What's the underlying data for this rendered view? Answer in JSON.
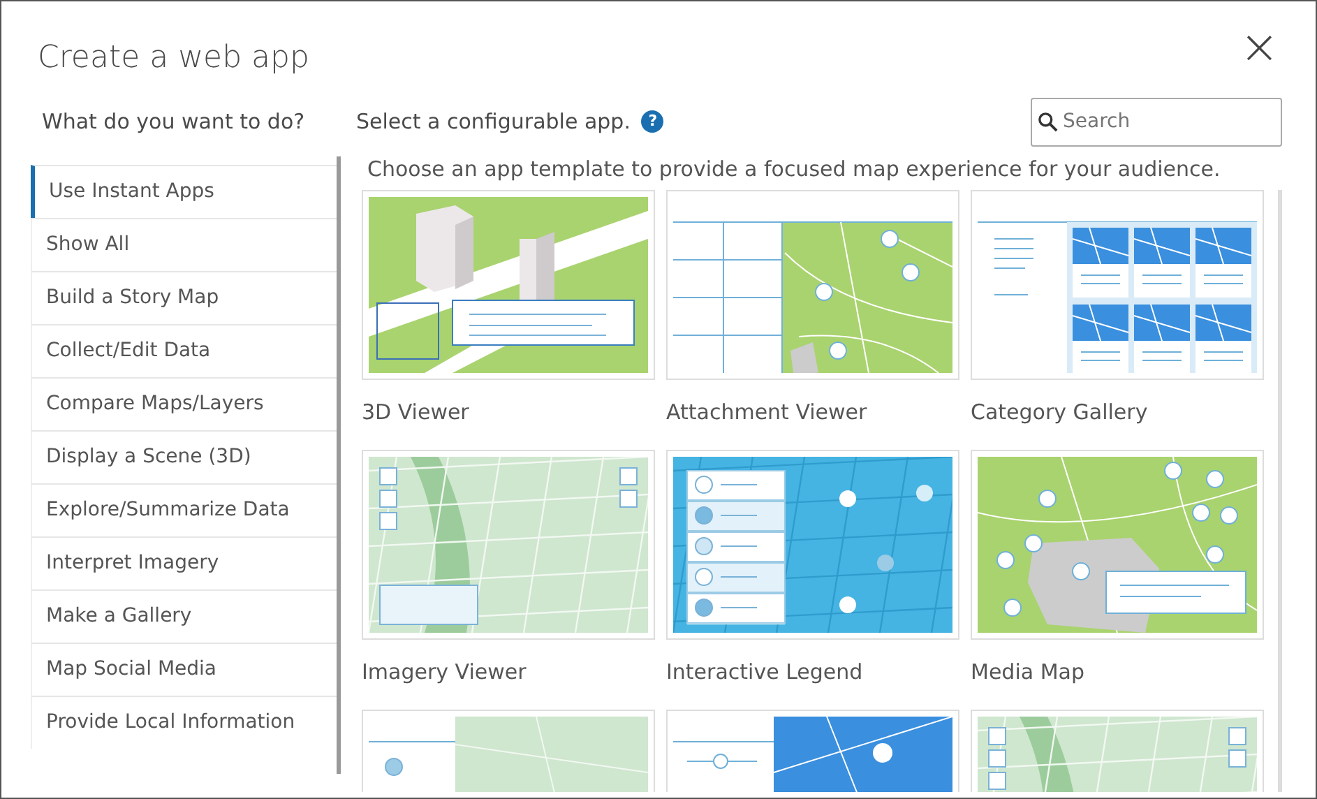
{
  "dialog": {
    "title": "Create a web app",
    "close": "×"
  },
  "sidebar": {
    "heading": "What do you want to do?",
    "items": [
      {
        "label": "Use Instant Apps",
        "selected": true
      },
      {
        "label": "Show All",
        "selected": false
      },
      {
        "label": "Build a Story Map",
        "selected": false
      },
      {
        "label": "Collect/Edit Data",
        "selected": false
      },
      {
        "label": "Compare Maps/Layers",
        "selected": false
      },
      {
        "label": "Display a Scene (3D)",
        "selected": false
      },
      {
        "label": "Explore/Summarize Data",
        "selected": false
      },
      {
        "label": "Interpret Imagery",
        "selected": false
      },
      {
        "label": "Make a Gallery",
        "selected": false
      },
      {
        "label": "Map Social Media",
        "selected": false
      },
      {
        "label": "Provide Local Information",
        "selected": false
      }
    ]
  },
  "main": {
    "heading": "Select a configurable app.",
    "help": "?",
    "search": {
      "placeholder": "Search"
    },
    "description": "Choose an app template to provide a focused map experience for your audience.",
    "apps": [
      {
        "label": "3D Viewer",
        "kind": "buildings"
      },
      {
        "label": "Attachment Viewer",
        "kind": "attachments"
      },
      {
        "label": "Category Gallery",
        "kind": "gallery"
      },
      {
        "label": "Imagery Viewer",
        "kind": "imagery"
      },
      {
        "label": "Interactive Legend",
        "kind": "legend"
      },
      {
        "label": "Media Map",
        "kind": "media"
      },
      {
        "kind": "split"
      },
      {
        "kind": "slider"
      },
      {
        "kind": "imagery"
      }
    ]
  }
}
